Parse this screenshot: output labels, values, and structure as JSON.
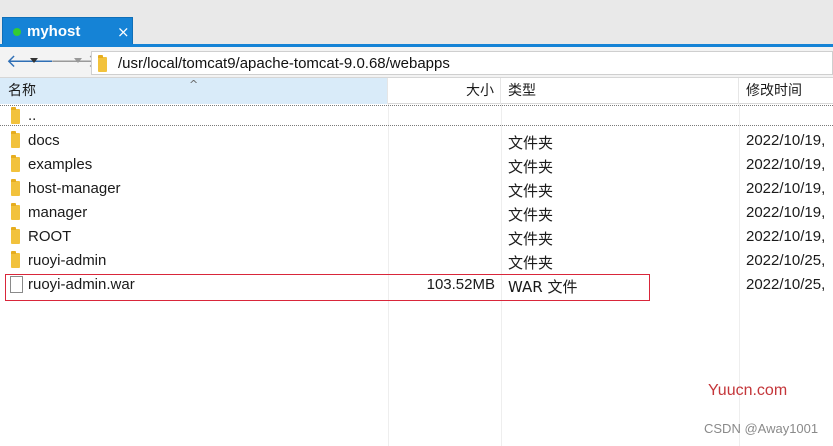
{
  "tab": {
    "title": "myhost",
    "close": "×"
  },
  "nav": {
    "back_glyph": "🡐",
    "forward_glyph": "🡒"
  },
  "address": {
    "path": "/usr/local/tomcat9/apache-tomcat-9.0.68/webapps"
  },
  "columns": {
    "name": "名称",
    "size": "大小",
    "type": "类型",
    "modified": "修改时间"
  },
  "parent_entry": {
    "name": ".."
  },
  "files": [
    {
      "name": "docs",
      "size": "",
      "type": "文件夹",
      "modified": "2022/10/19,",
      "icon": "folder-icon"
    },
    {
      "name": "examples",
      "size": "",
      "type": "文件夹",
      "modified": "2022/10/19,",
      "icon": "folder-icon"
    },
    {
      "name": "host-manager",
      "size": "",
      "type": "文件夹",
      "modified": "2022/10/19,",
      "icon": "folder-icon"
    },
    {
      "name": "manager",
      "size": "",
      "type": "文件夹",
      "modified": "2022/10/19,",
      "icon": "folder-icon"
    },
    {
      "name": "ROOT",
      "size": "",
      "type": "文件夹",
      "modified": "2022/10/19,",
      "icon": "folder-icon"
    },
    {
      "name": "ruoyi-admin",
      "size": "",
      "type": "文件夹",
      "modified": "2022/10/25,",
      "icon": "folder-icon"
    },
    {
      "name": "ruoyi-admin.war",
      "size": "103.52MB",
      "type": "WAR 文件",
      "modified": "2022/10/25,",
      "icon": "file-icon"
    }
  ],
  "watermarks": {
    "site": "Yuucn.com",
    "csdn": "CSDN @Away1001"
  },
  "colors": {
    "tab_blue": "#1583d6",
    "status_dot": "#33cc33",
    "highlight_border": "#d9263a"
  }
}
